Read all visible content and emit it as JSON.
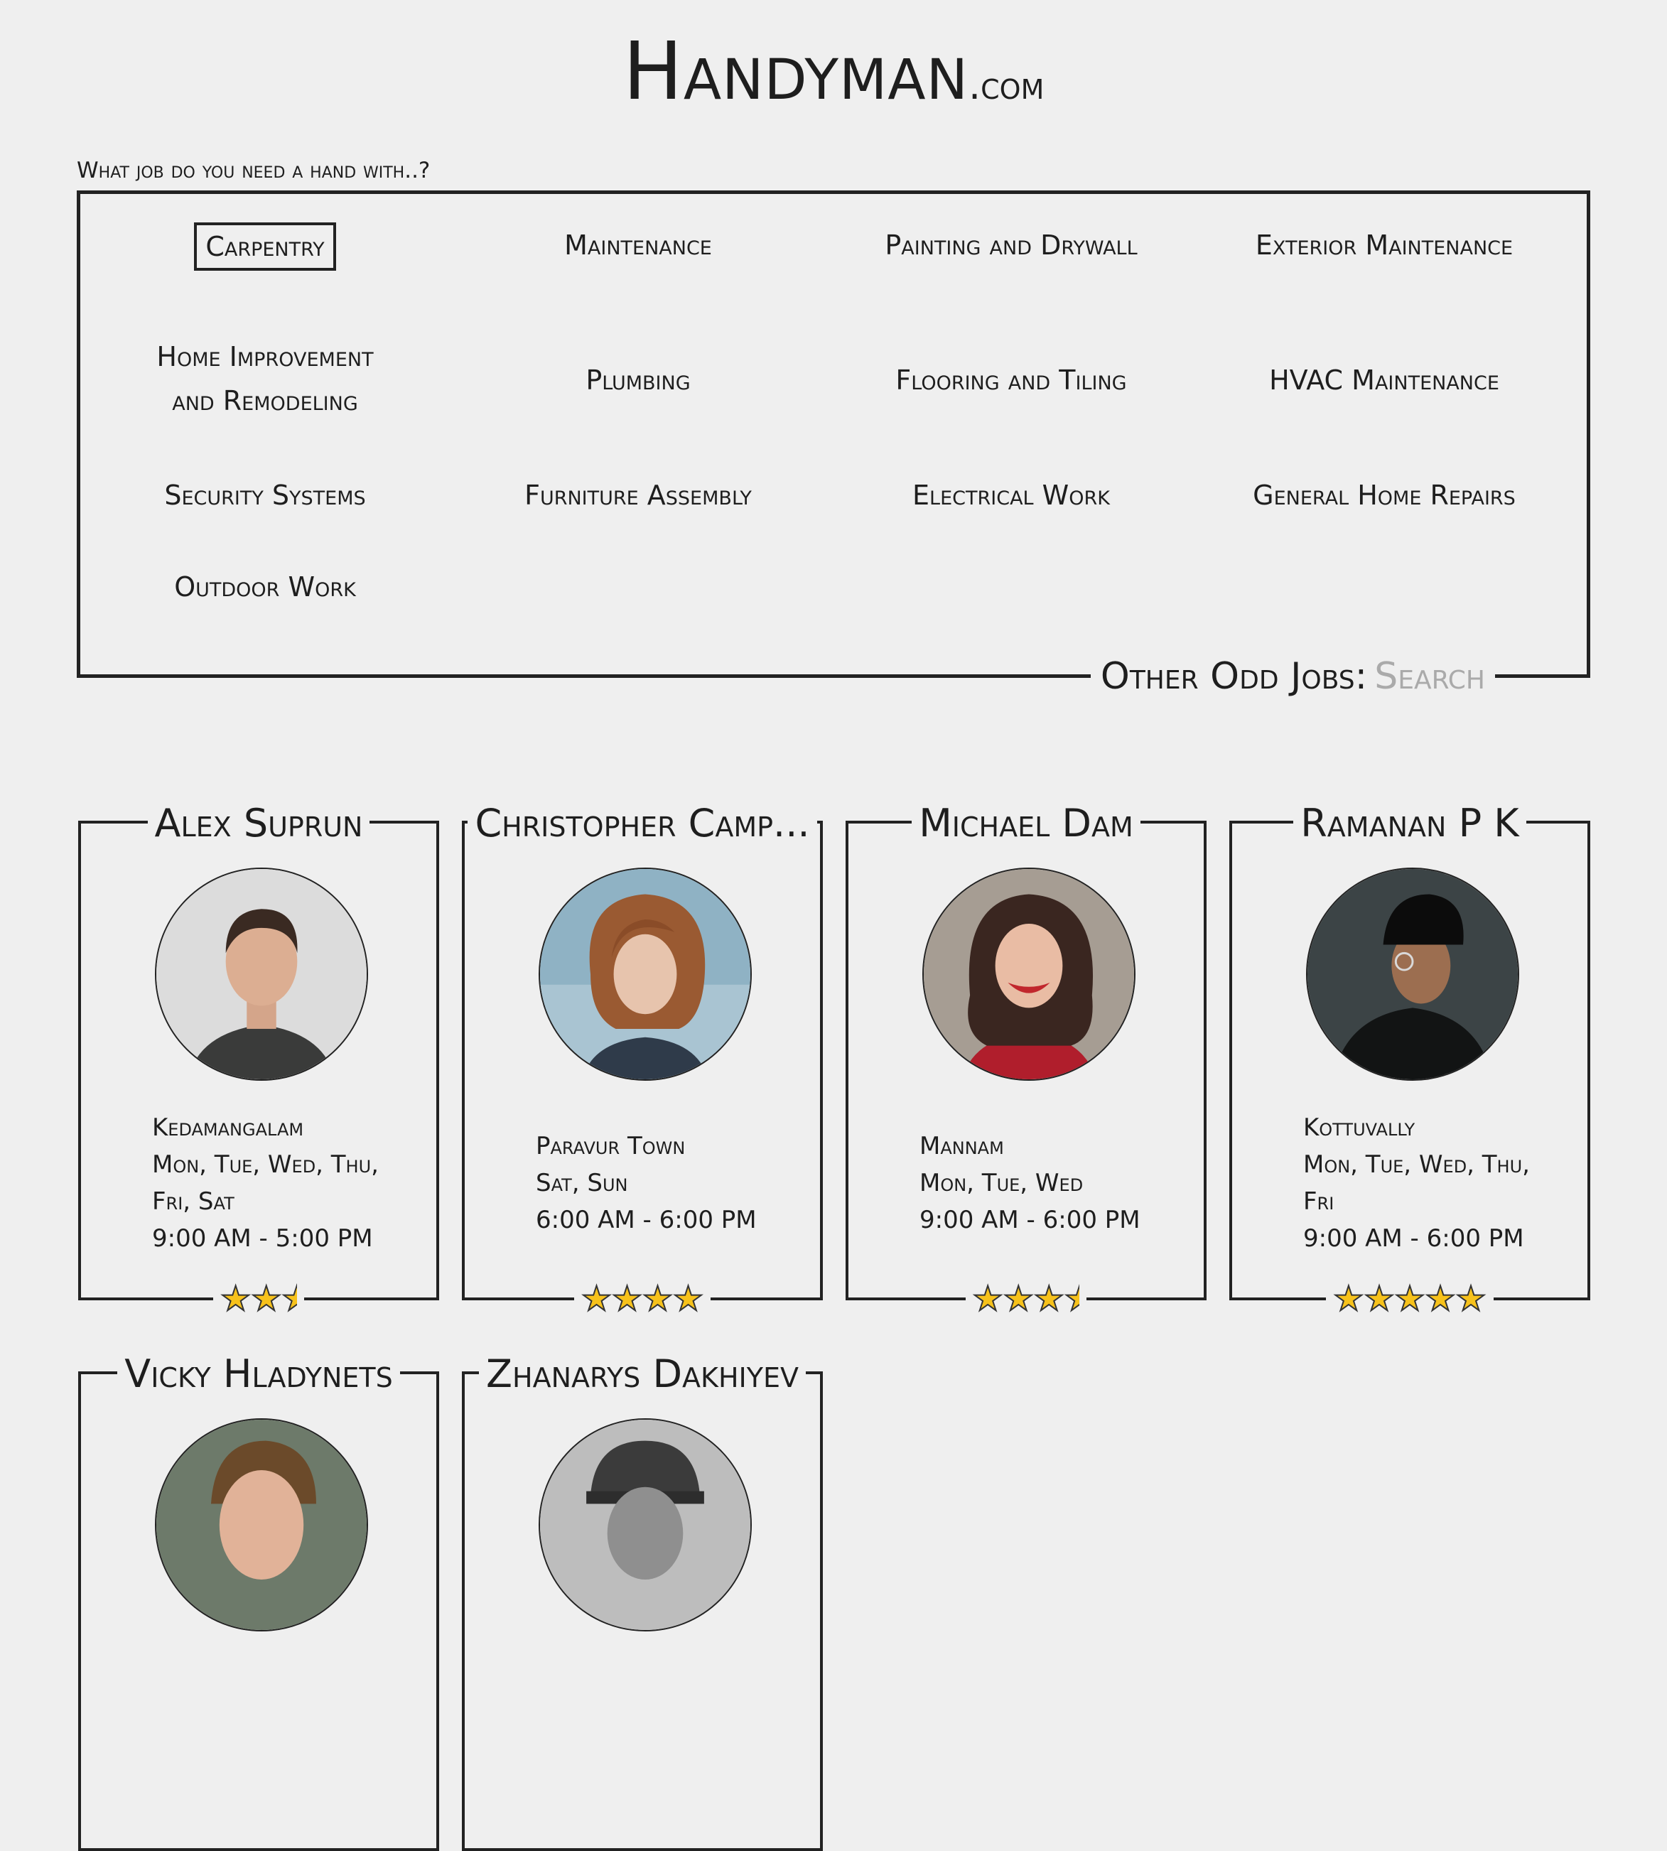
{
  "brand": {
    "name": "Handyman",
    "tld": ".com"
  },
  "prompt": "What job do you need a hand with..?",
  "categories": [
    "Carpentry",
    "Maintenance",
    "Painting and Drywall",
    "Exterior Maintenance",
    "Home Improvement and Remodeling",
    "Plumbing",
    "Flooring and Tiling",
    "HVAC Maintenance",
    "Security Systems",
    "Furniture Assembly",
    "Electrical Work",
    "General Home Repairs",
    "Outdoor Work"
  ],
  "selected_category": "Carpentry",
  "other_jobs": {
    "label": "Other Odd Jobs:",
    "placeholder": "Search"
  },
  "workers": [
    {
      "name": "Alex Suprun",
      "location": "Kedamangalam",
      "days_line1": "Mon, Tue, Wed, Thu,",
      "days_line2": "Fri, Sat",
      "hours": "9:00 AM - 5:00 PM",
      "rating": 2.5
    },
    {
      "name": "Christopher Camp...",
      "location": "Paravur Town",
      "days_line1": "Sat, Sun",
      "days_line2": "",
      "hours": "6:00 AM - 6:00 PM",
      "rating": 4
    },
    {
      "name": "Michael Dam",
      "location": "Mannam",
      "days_line1": "Mon, Tue, Wed",
      "days_line2": "",
      "hours": "9:00 AM - 6:00 PM",
      "rating": 3.5
    },
    {
      "name": "Ramanan P K",
      "location": "Kottuvally",
      "days_line1": "Mon, Tue, Wed, Thu,",
      "days_line2": "Fri",
      "hours": "9:00 AM - 6:00 PM",
      "rating": 5
    },
    {
      "name": "Vicky Hladynets",
      "location": "",
      "days_line1": "",
      "days_line2": "",
      "hours": "",
      "rating": null
    },
    {
      "name": "Zhanarys Dakhiyev",
      "location": "",
      "days_line1": "",
      "days_line2": "",
      "hours": "",
      "rating": null
    }
  ],
  "colors": {
    "background": "#efefef",
    "ink": "#1e1e1e",
    "star": "#f7c21b",
    "placeholder": "#aaaaaa"
  }
}
